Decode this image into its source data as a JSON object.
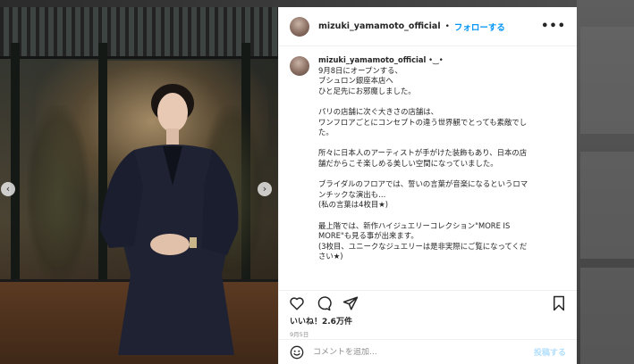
{
  "post": {
    "username": "mizuki_yamamoto_official",
    "header_dot": "•",
    "follow_label": "フォローする",
    "more_label": "•••",
    "caption_username": "mizuki_yamamoto_official",
    "caption_suffix": " •‿•",
    "caption_lines": [
      "9月8日にオープンする、",
      "ブシュロン銀座本店へ",
      "ひと足先にお邪魔しました。",
      "",
      "パリの店舗に次ぐ大きさの店舗は、",
      "ワンフロアごとにコンセプトの違う世界観でとっても素敵でし",
      "た。",
      "",
      "所々に日本人のアーティストが手がけた装飾もあり、日本の店",
      "舗だからこそ楽しめる美しい空間になっていました。",
      "",
      "ブライダルのフロアでは、誓いの言葉が音楽になるというロマ",
      "ンチックな演出も…",
      "(私の言葉は4枚目★)",
      "",
      "最上階では、新作ハイジュエリーコレクション\"MORE IS",
      "MORE\"も見る事が出来ます。",
      "(3枚目、ユニークなジュエリーは是非実際にご覧になってくだ",
      "さい★)"
    ],
    "likes": "いいね！2.6万件",
    "date": "9月5日",
    "comment_placeholder": "コメントを追加...",
    "post_button": "投稿する",
    "nav_prev": "‹",
    "nav_next": "›"
  },
  "colors": {
    "accent": "#0095f6",
    "post_disabled": "#b2dffc",
    "text": "#262626",
    "muted": "#8e8e8e"
  },
  "icons": [
    "heart-icon",
    "comment-icon",
    "share-icon",
    "bookmark-icon",
    "emoji-icon",
    "chevron-left-icon",
    "chevron-right-icon"
  ]
}
